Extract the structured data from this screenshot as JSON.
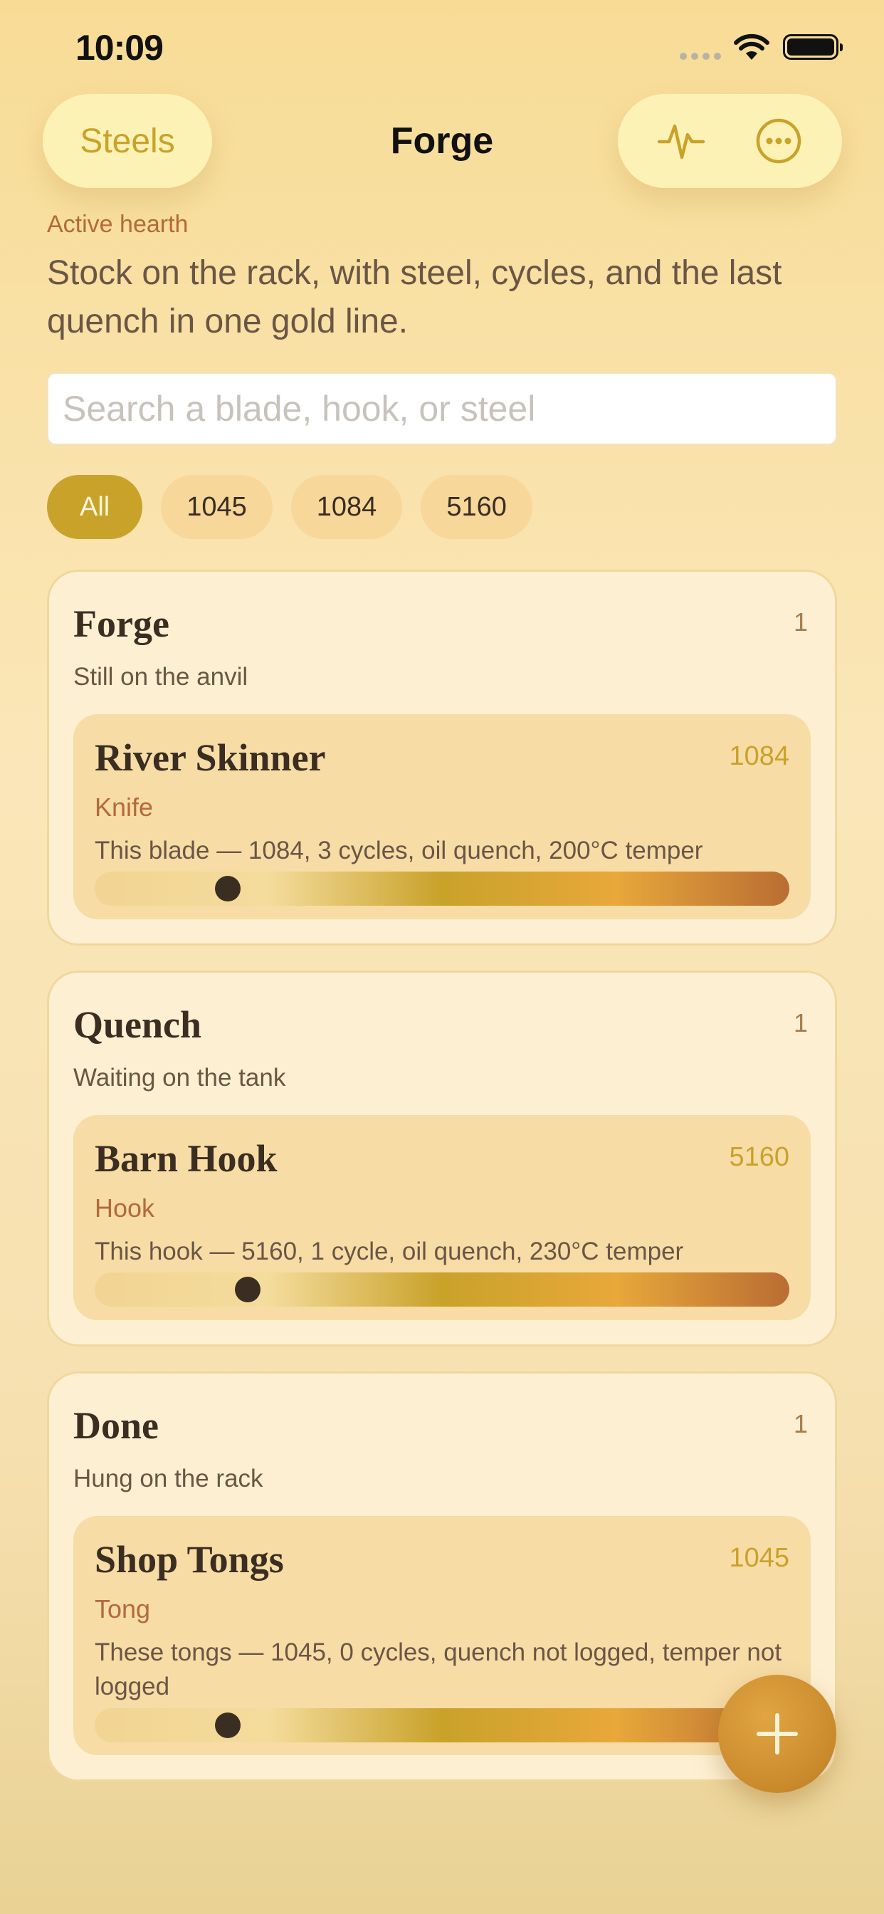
{
  "status_bar": {
    "time": "10:09"
  },
  "nav": {
    "back_label": "Steels",
    "title": "Forge"
  },
  "header": {
    "eyebrow": "Active hearth",
    "lede": "Stock on the rack, with steel, cycles, and the last quench in one gold line."
  },
  "search": {
    "placeholder": "Search a blade, hook, or steel",
    "value": ""
  },
  "filters": {
    "chips": [
      "All",
      "1045",
      "1084",
      "5160"
    ],
    "selected": "All"
  },
  "sections": [
    {
      "title": "Forge",
      "count": "1",
      "subtitle": "Still on the anvil",
      "items": [
        {
          "name": "River Skinner",
          "steel": "1084",
          "type": "Knife",
          "summary": "This blade — 1084, 3 cycles, oil quench, 200°C temper",
          "heat_level": 0.18
        }
      ]
    },
    {
      "title": "Quench",
      "count": "1",
      "subtitle": "Waiting on the tank",
      "items": [
        {
          "name": "Barn Hook",
          "steel": "5160",
          "type": "Hook",
          "summary": "This hook — 5160, 1 cycle, oil quench, 230°C temper",
          "heat_level": 0.21
        }
      ]
    },
    {
      "title": "Done",
      "count": "1",
      "subtitle": "Hung on the rack",
      "items": [
        {
          "name": "Shop Tongs",
          "steel": "1045",
          "type": "Tong",
          "summary": "These tongs — 1045, 0 cycles, quench not logged, temper not logged",
          "heat_level": 0.18
        }
      ]
    }
  ],
  "colors": {
    "accent": "#c9a22a",
    "secondary": "#b36a38",
    "text": "#3a2e22"
  },
  "icons": {
    "activity": "activity-icon",
    "more": "more-icon",
    "add": "plus-icon"
  }
}
